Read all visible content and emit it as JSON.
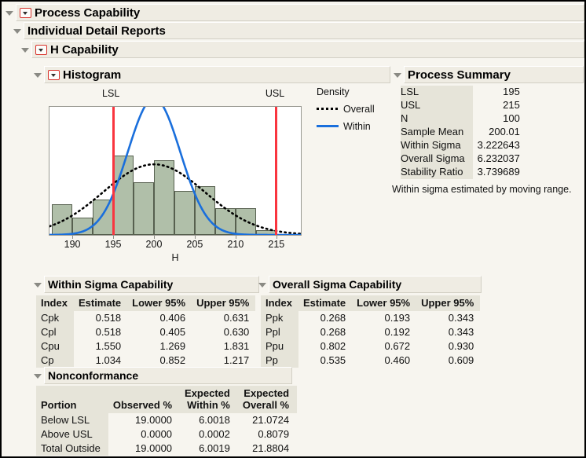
{
  "outline": {
    "process_capability": "Process Capability",
    "individual_detail_reports": "Individual Detail Reports",
    "h_capability": "H Capability",
    "histogram": "Histogram",
    "process_summary": "Process Summary",
    "within_sigma_capability": "Within Sigma Capability",
    "overall_sigma_capability": "Overall Sigma Capability",
    "nonconformance": "Nonconformance"
  },
  "process_summary": {
    "rows": [
      {
        "label": "LSL",
        "value": "195"
      },
      {
        "label": "USL",
        "value": "215"
      },
      {
        "label": "N",
        "value": "100"
      },
      {
        "label": "Sample Mean",
        "value": "200.01"
      },
      {
        "label": "Within Sigma",
        "value": "3.222643"
      },
      {
        "label": "Overall Sigma",
        "value": "6.232037"
      },
      {
        "label": "Stability Ratio",
        "value": "3.739689"
      }
    ],
    "note": "Within sigma estimated by moving range."
  },
  "within_sigma": {
    "headers": [
      "Index",
      "Estimate",
      "Lower 95%",
      "Upper 95%"
    ],
    "rows": [
      [
        "Cpk",
        "0.518",
        "0.406",
        "0.631"
      ],
      [
        "Cpl",
        "0.518",
        "0.405",
        "0.630"
      ],
      [
        "Cpu",
        "1.550",
        "1.269",
        "1.831"
      ],
      [
        "Cp",
        "1.034",
        "0.852",
        "1.217"
      ]
    ]
  },
  "overall_sigma": {
    "headers": [
      "Index",
      "Estimate",
      "Lower 95%",
      "Upper 95%"
    ],
    "rows": [
      [
        "Ppk",
        "0.268",
        "0.193",
        "0.343"
      ],
      [
        "Ppl",
        "0.268",
        "0.192",
        "0.343"
      ],
      [
        "Ppu",
        "0.802",
        "0.672",
        "0.930"
      ],
      [
        "Pp",
        "0.535",
        "0.460",
        "0.609"
      ]
    ]
  },
  "nonconformance": {
    "headers": [
      "Portion",
      "Observed %",
      "Expected\nWithin %",
      "Expected\nOverall %"
    ],
    "headers_top": [
      "",
      "",
      "Expected",
      "Expected"
    ],
    "headers_bottom": [
      "Portion",
      "Observed %",
      "Within %",
      "Overall %"
    ],
    "rows": [
      [
        "Below LSL",
        "19.0000",
        "6.0018",
        "21.0724"
      ],
      [
        "Above USL",
        "0.0000",
        "0.0002",
        "0.8079"
      ],
      [
        "Total Outside",
        "19.0000",
        "6.0019",
        "21.8804"
      ]
    ]
  },
  "colors": {
    "spec_line": "#f9353f",
    "bar_fill": "#b0bfa9",
    "bar_stroke": "#57604f",
    "within_curve": "#1a6fdc",
    "overall_curve": "#000000",
    "panel_bg": "#f7f5ef",
    "header_plate": "#efece3",
    "table_key_bg": "#e6e4d9"
  },
  "chart_data": {
    "type": "bar",
    "title": "Histogram",
    "xlabel": "H",
    "ylabel": "Density",
    "xlim": [
      187.2,
      218.0
    ],
    "xticks": [
      190,
      195,
      200,
      205,
      210,
      215
    ],
    "grid": false,
    "bin_width": 2.5,
    "bin_edges": [
      187.5,
      190.0,
      192.5,
      195.0,
      197.5,
      200.0,
      202.5,
      205.0,
      207.5,
      210.0,
      212.5,
      215.0
    ],
    "counts": [
      7,
      4,
      8,
      18,
      12,
      17,
      10,
      11,
      6,
      6,
      1
    ],
    "spec_limits": {
      "LSL": 195,
      "USL": 215
    },
    "spec_labels": [
      "LSL",
      "USL"
    ],
    "legend": {
      "title": "Density",
      "position": "right",
      "entries": [
        {
          "name": "Overall",
          "style": "dotted",
          "color": "#000000"
        },
        {
          "name": "Within",
          "style": "solid",
          "color": "#1a6fdc"
        }
      ]
    },
    "curves": [
      {
        "name": "Overall",
        "distribution": "normal",
        "mean": 200.01,
        "sigma": 6.232037
      },
      {
        "name": "Within",
        "distribution": "normal",
        "mean": 200.01,
        "sigma": 3.222643
      }
    ]
  }
}
